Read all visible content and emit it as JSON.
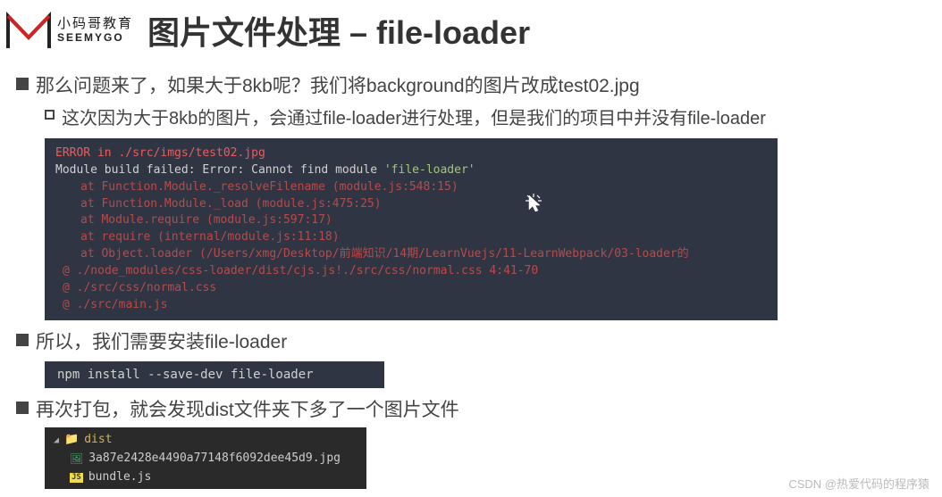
{
  "logo": {
    "cn": "小码哥教育",
    "en": "SEEMYGO"
  },
  "title": "图片文件处理 – file-loader",
  "bullets": {
    "b1": "那么问题来了，如果大于8kb呢？我们将background的图片改成test02.jpg",
    "b1_sub": "这次因为大于8kb的图片，会通过file-loader进行处理，但是我们的项目中并没有file-loader",
    "b2": "所以，我们需要安装file-loader",
    "b3": "再次打包，就会发现dist文件夹下多了一个图片文件"
  },
  "error_terminal": {
    "line1": "ERROR in ./src/imgs/test02.jpg",
    "line2_a": "Module build failed: Error: Cannot find module ",
    "line2_b": "'file-loader'",
    "trace1": "at Function.Module._resolveFilename (module.js:548:15)",
    "trace2": "at Function.Module._load (module.js:475:25)",
    "trace3": "at Module.require (module.js:597:17)",
    "trace4": "at require (internal/module.js:11:18)",
    "trace5": "at Object.loader (/Users/xmg/Desktop/前端知识/14期/LearnVuejs/11-LearnWebpack/03-loader的",
    "at1": "@ ./node_modules/css-loader/dist/cjs.js!./src/css/normal.css 4:41-70",
    "at2": "@ ./src/css/normal.css",
    "at3": "@ ./src/main.js"
  },
  "install_cmd": "npm install --save-dev file-loader",
  "tree": {
    "root": "dist",
    "img_file": "3a87e2428e4490a77148f6092dee45d9.jpg",
    "js_badge": "JS",
    "js_file": "bundle.js"
  },
  "watermark": "CSDN @热爱代码的程序猿"
}
